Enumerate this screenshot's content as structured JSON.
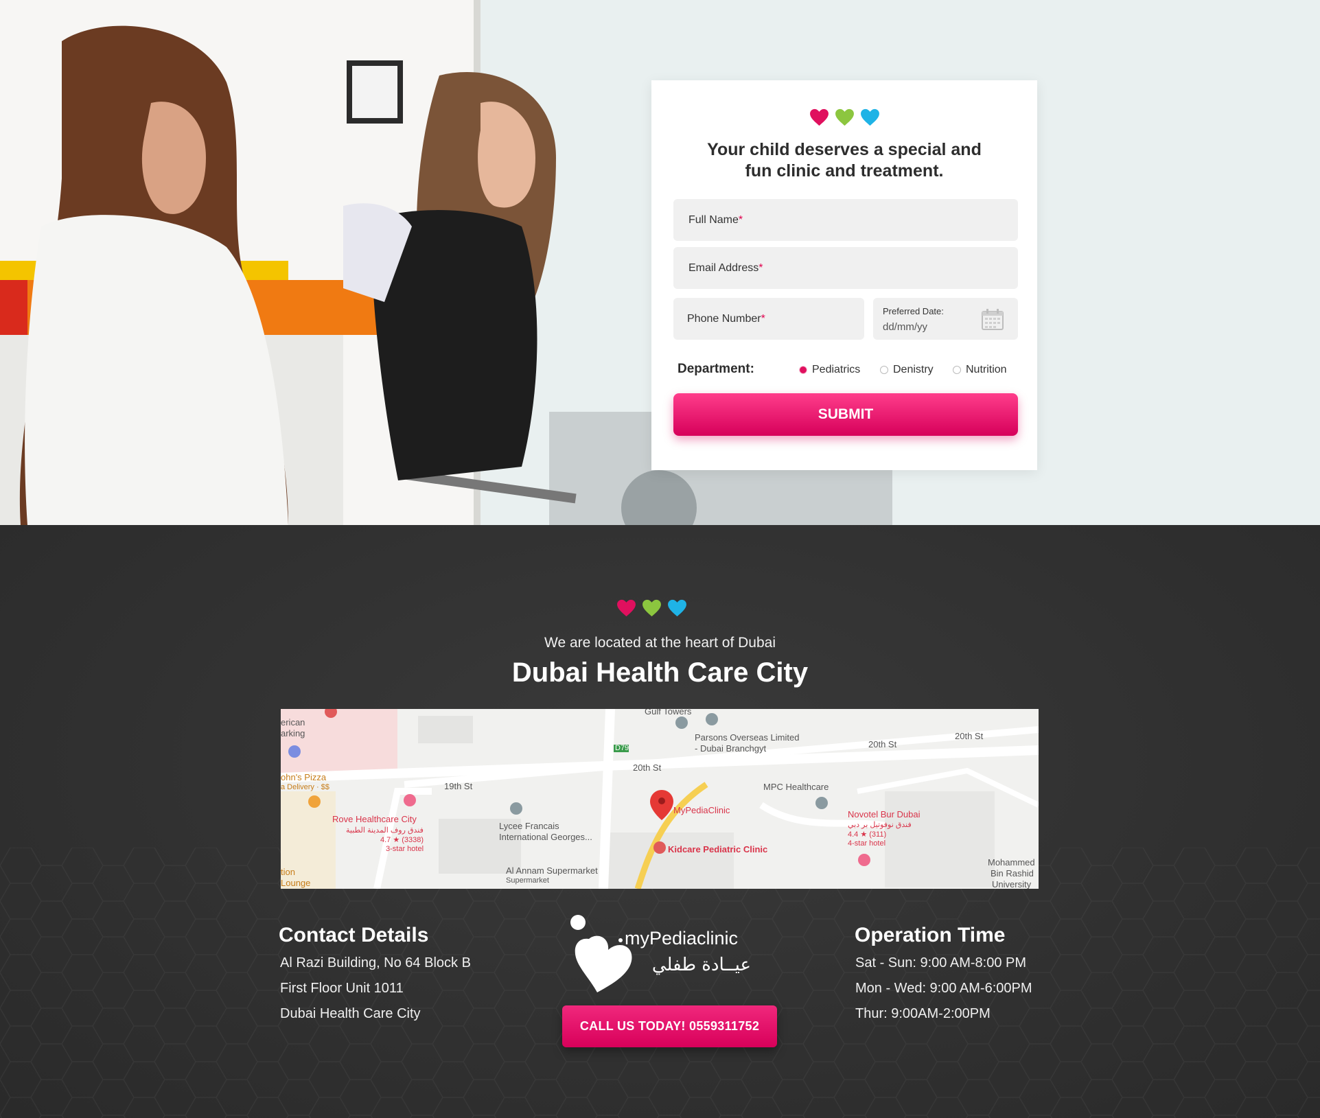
{
  "form": {
    "title_line1": "Your child deserves a special and",
    "title_line2": "fun clinic and treatment.",
    "full_name_label": "Full Name",
    "email_label": "Email Address",
    "phone_label": "Phone Number",
    "required_mark": "*",
    "date_label": "Preferred Date:",
    "date_placeholder": "dd/mm/yy",
    "department_label": "Department:",
    "departments": [
      {
        "label": "Pediatrics",
        "selected": true
      },
      {
        "label": "Denistry",
        "selected": false
      },
      {
        "label": "Nutrition",
        "selected": false
      }
    ],
    "submit_label": "SUBMIT"
  },
  "colors": {
    "accent_pink": "#e0105e",
    "heart_green": "#8cc63f",
    "heart_blue": "#1fb3e6",
    "dark_bg": "#333333"
  },
  "location": {
    "subtitle": "We are located at the heart of Dubai",
    "title": "Dubai Health Care City"
  },
  "map": {
    "labels": {
      "gulf_towers": "Gulf Towers",
      "parsons": "Parsons Overseas Limited",
      "parsons2": "- Dubai Branchgyt",
      "st20a": "20th St",
      "st20b": "20th St",
      "st20c": "20th St",
      "st19": "19th St",
      "d79": "D79",
      "american": "erican",
      "parking": "arking",
      "johns": "ohn's Pizza",
      "delivery": "a Delivery · $$",
      "rove": "Rove Healthcare City",
      "rove_ar": "فندق روف المدينة الطبية",
      "rove_rating": "4.7 ★ (3338)",
      "rove_type": "3-star hotel",
      "lycee": "Lycee Francais",
      "lycee2": "International Georges...",
      "mpc": "MPC Healthcare",
      "mypedia": "MyPediaClinic",
      "kidcare": "Kidcare Pediatric Clinic",
      "novotel": "Novotel Bur Dubai",
      "novotel_ar": "فندق نوفوتيل بر دبي",
      "novotel_rating": "4.4 ★ (311)",
      "novotel_type": "4-star hotel",
      "annam": "Al Annam Supermarket",
      "annam2": "Supermarket",
      "station": "tion",
      "lounge": "Lounge",
      "mohammed": "Mohammed",
      "binrashid": "Bin Rashid",
      "university": "University"
    }
  },
  "contact": {
    "title": "Contact Details",
    "lines": [
      "Al Razi Building, No 64 Block B",
      "First Floor Unit 1011",
      "Dubai Health Care City"
    ]
  },
  "logo": {
    "name": "myPediaclinic",
    "arabic": "عيــادة طفلي"
  },
  "call_button": "CALL US TODAY! 0559311752",
  "hours": {
    "title": "Operation Time",
    "lines": [
      "Sat - Sun: 9:00 AM-8:00 PM",
      "Mon - Wed: 9:00 AM-6:00PM",
      "Thur: 9:00AM-2:00PM"
    ]
  }
}
